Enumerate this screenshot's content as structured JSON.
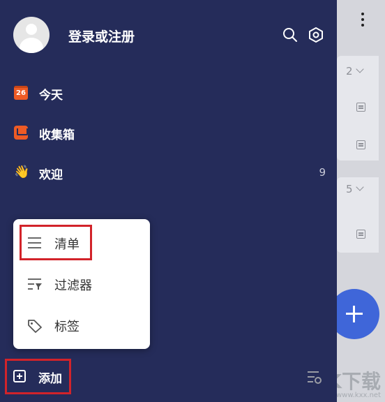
{
  "header": {
    "login_text": "登录或注册",
    "search_icon": "search-icon",
    "settings_icon": "settings-icon"
  },
  "nav": {
    "today": {
      "label": "今天",
      "icon": "calendar-icon",
      "date": "26"
    },
    "inbox": {
      "label": "收集箱",
      "icon": "inbox-icon"
    },
    "welcome": {
      "label": "欢迎",
      "icon": "waving-hand-icon",
      "emoji": "👋",
      "count": "9"
    }
  },
  "popup_menu": {
    "items": [
      {
        "label": "清单",
        "icon": "list-icon"
      },
      {
        "label": "过滤器",
        "icon": "filter-icon"
      },
      {
        "label": "标签",
        "icon": "tag-icon"
      }
    ]
  },
  "footer": {
    "add_label": "添加",
    "add_icon": "add-square-icon"
  },
  "background": {
    "project_counts": [
      "2",
      "5"
    ],
    "watermark": "K下载",
    "watermark_url": "www.kxx.net"
  },
  "colors": {
    "drawer": "#252c5a",
    "accent_orange": "#ee5b25",
    "fab": "#3f66d9",
    "highlight": "#d2232a"
  }
}
